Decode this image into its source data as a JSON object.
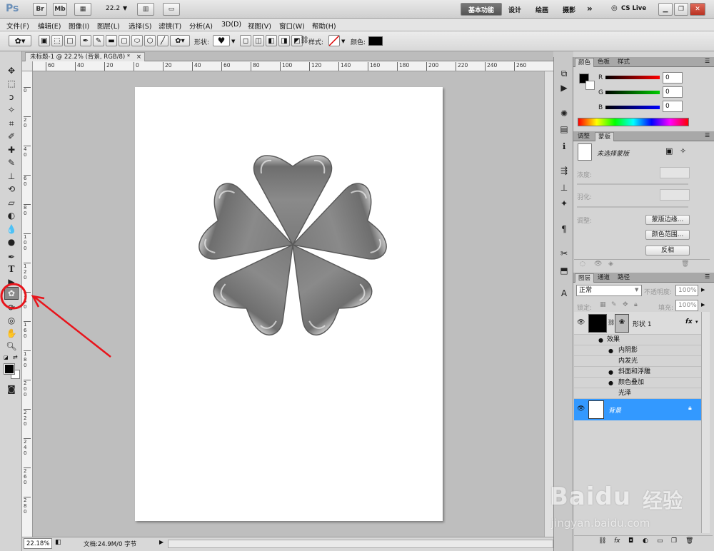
{
  "app": {
    "logo": "Ps",
    "bridge": "Br",
    "minibridge": "Mb",
    "zoom": "22.2",
    "workspace_active": "基本功能",
    "workspaces": [
      "设计",
      "绘画",
      "摄影"
    ],
    "more": "»",
    "cslive": "CS Live"
  },
  "menu": [
    "文件(F)",
    "编辑(E)",
    "图像(I)",
    "图层(L)",
    "选择(S)",
    "滤镜(T)",
    "分析(A)",
    "3D(D)",
    "视图(V)",
    "窗口(W)",
    "帮助(H)"
  ],
  "options": {
    "shape_label": "形状:",
    "style_label": "样式:",
    "color_label": "颜色:",
    "color_value": "#000000"
  },
  "doc": {
    "tab_title": "未标题-1 @ 22.2% (背景, RGB/8) *",
    "close": "×"
  },
  "ruler": {
    "h_ticks": [
      "60",
      "40",
      "20",
      "0",
      "20",
      "40",
      "60",
      "80",
      "100",
      "120",
      "140",
      "160",
      "180",
      "200",
      "220",
      "240",
      "260"
    ],
    "v_ticks": [
      "0",
      "2 0",
      "4 0",
      "6 0",
      "8 0",
      "1 0 0",
      "1 2 0",
      "1 4 0",
      "1 6 0",
      "1 8 0",
      "2 0 0",
      "2 2 0",
      "2 4 0",
      "2 6 0",
      "2 8 0"
    ]
  },
  "status": {
    "zoom": "22.18%",
    "doc_info": "文档:24.9M/0 字节"
  },
  "color_panel": {
    "tabs": [
      "颜色",
      "色板",
      "样式"
    ],
    "channels": [
      {
        "name": "R",
        "value": "0"
      },
      {
        "name": "G",
        "value": "0"
      },
      {
        "name": "B",
        "value": "0"
      }
    ]
  },
  "mask_panel": {
    "tabs": [
      "调整",
      "蒙版"
    ],
    "no_mask": "未选择蒙版",
    "density": "浓度:",
    "feather": "羽化:",
    "refine": "调整:",
    "buttons": [
      "蒙版边缘...",
      "颜色范围...",
      "反相"
    ]
  },
  "layers_panel": {
    "tabs": [
      "图层",
      "通道",
      "路径"
    ],
    "blend": "正常",
    "opacity_label": "不透明度:",
    "opacity": "100%",
    "lock_label": "锁定:",
    "fill_label": "填充:",
    "fill": "100%",
    "shape_layer": "形状 1",
    "fx": "fx",
    "effects_label": "效果",
    "effects": [
      {
        "name": "内阴影",
        "visible": true
      },
      {
        "name": "内发光",
        "visible": false
      },
      {
        "name": "斜面和浮雕",
        "visible": true
      },
      {
        "name": "颜色叠加",
        "visible": true
      },
      {
        "name": "光泽",
        "visible": false
      }
    ],
    "background_layer": "背景"
  },
  "watermark": {
    "brand": "Baidu",
    "cn": "经验",
    "url": "jingyan.baidu.com"
  },
  "colors": {
    "highlight": "#3399ff",
    "annotation": "#e8141b",
    "panel": "#d4d4d4"
  }
}
